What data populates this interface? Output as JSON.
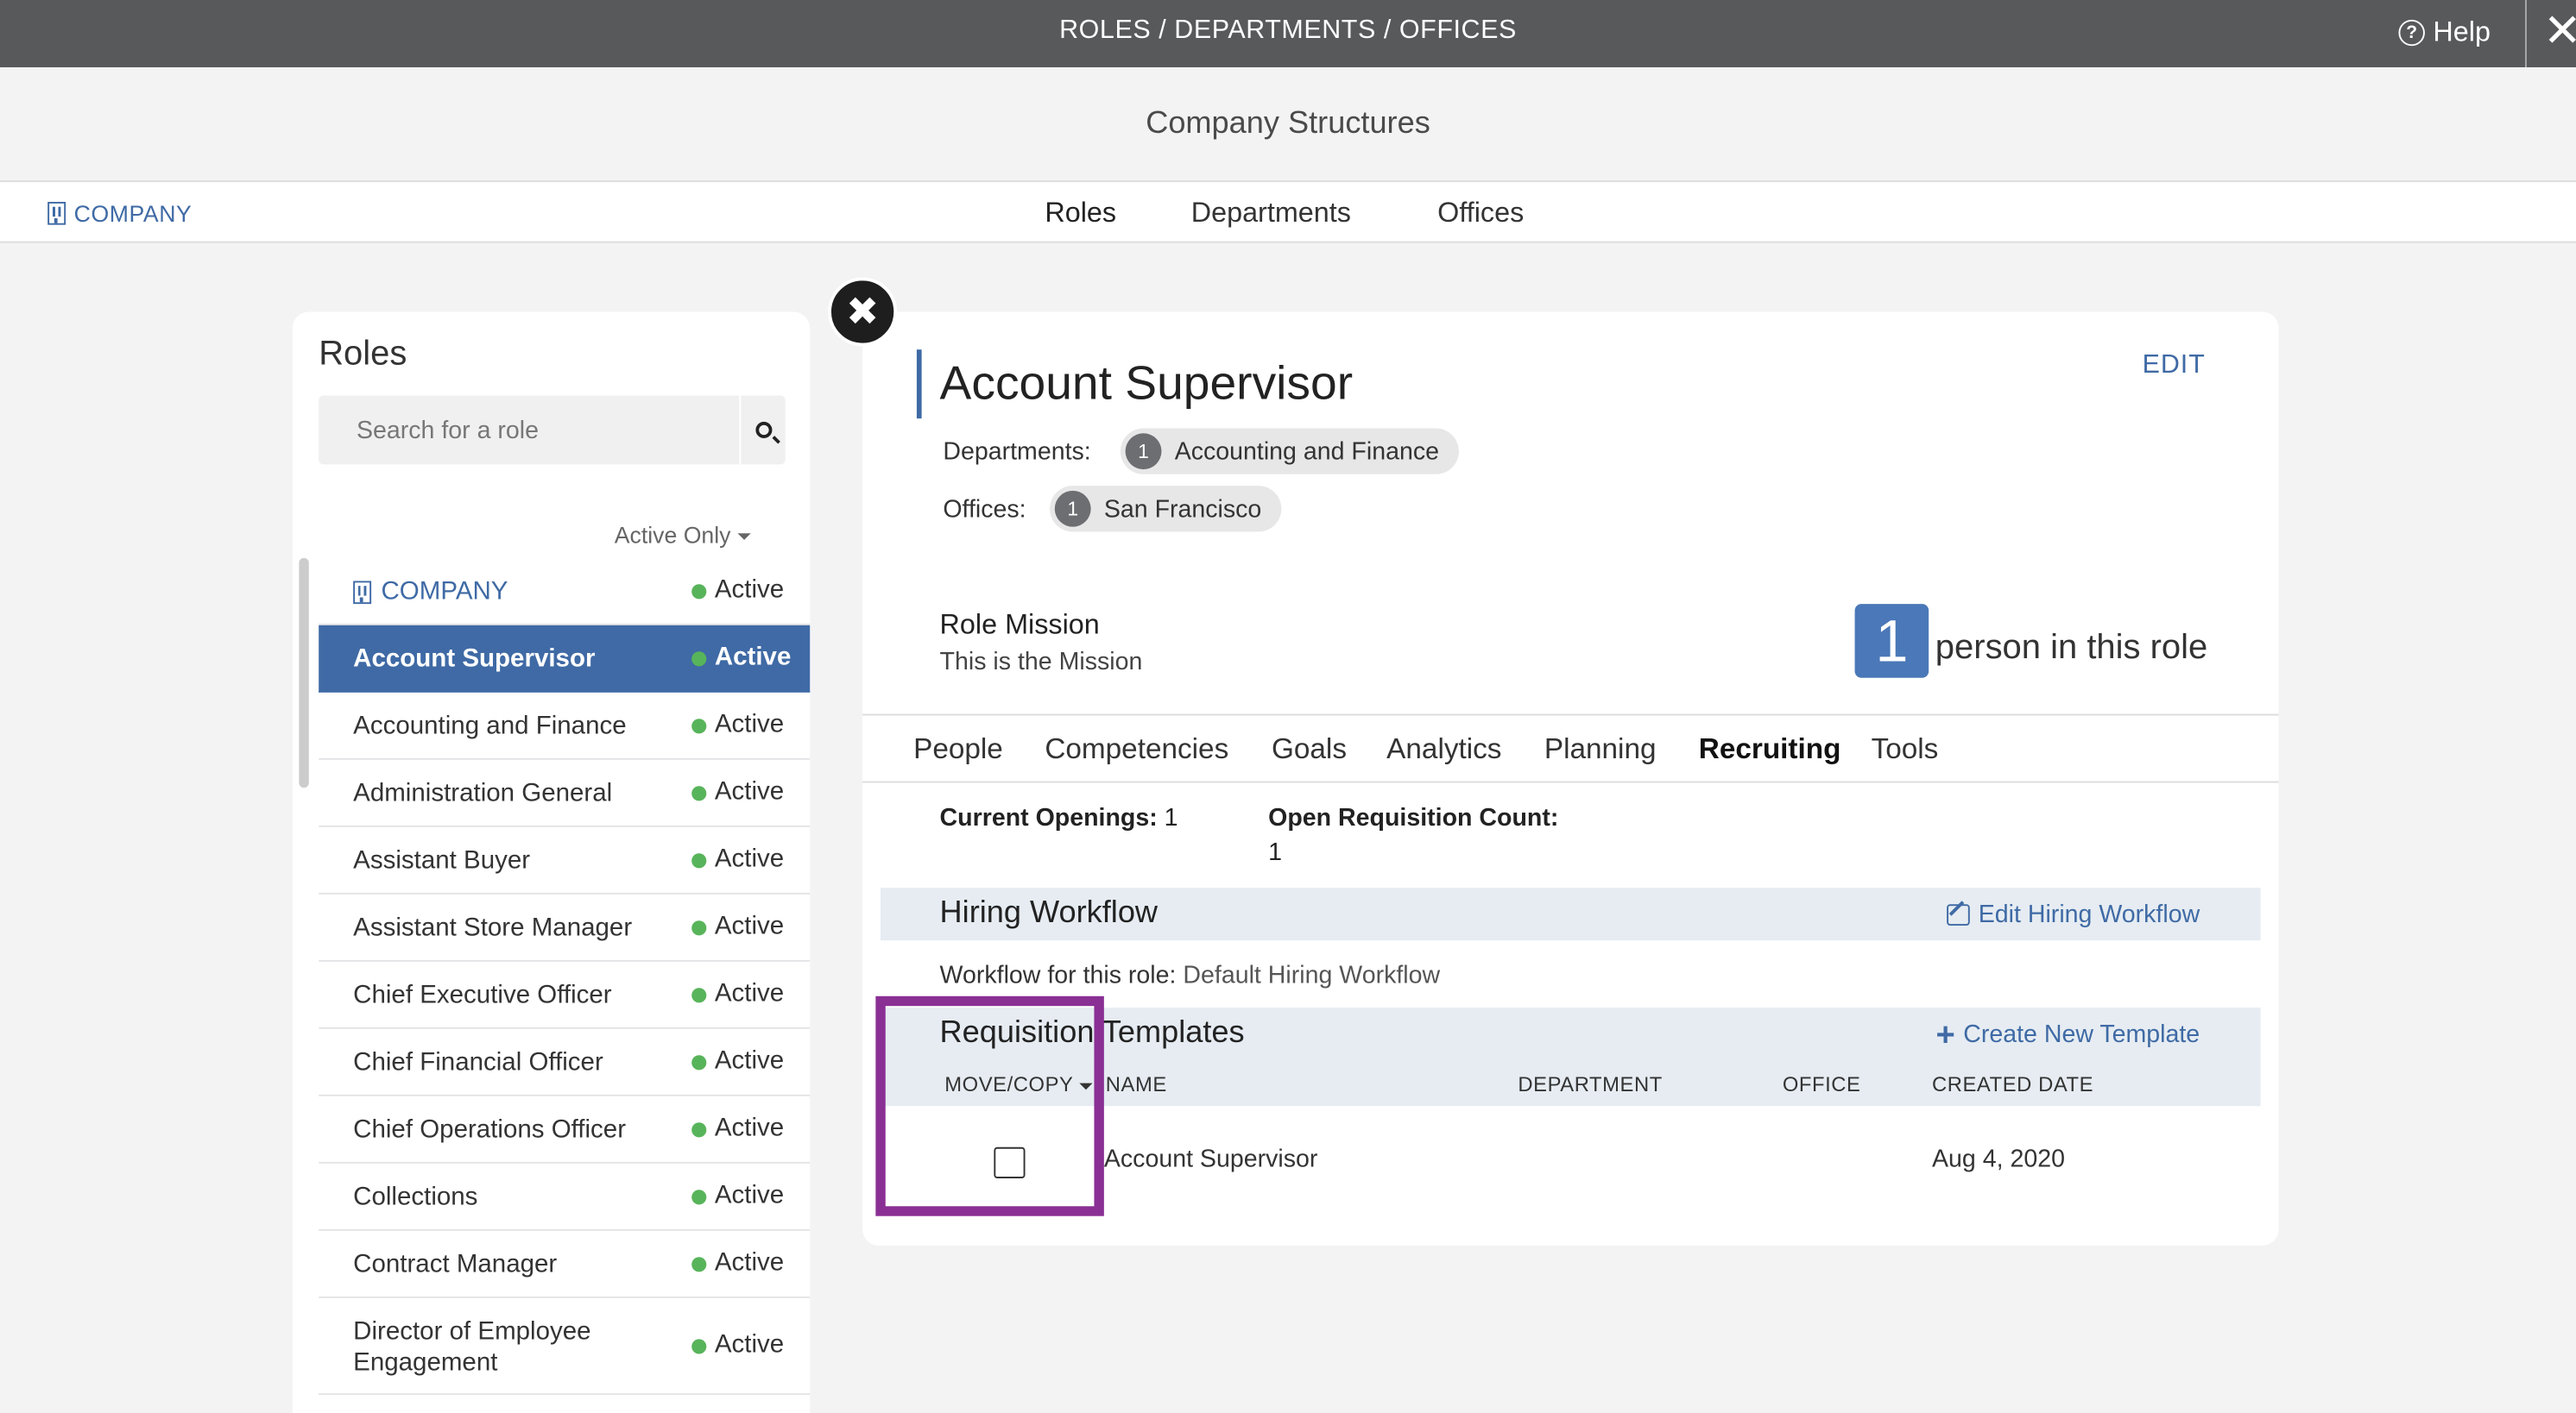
{
  "topbar": {
    "title": "ROLES / DEPARTMENTS / OFFICES",
    "help_label": "Help",
    "close_glyph": "✕"
  },
  "page": {
    "title": "Company Structures"
  },
  "nav": {
    "company_label": "COMPANY",
    "tabs": [
      {
        "label": "Roles"
      },
      {
        "label": "Departments"
      },
      {
        "label": "Offices"
      }
    ]
  },
  "roles_panel": {
    "header": "Roles",
    "search_placeholder": "Search for a role",
    "filter_label": "Active Only",
    "items": [
      {
        "name": "COMPANY",
        "status": "Active"
      },
      {
        "name": "Account Supervisor",
        "status": "Active"
      },
      {
        "name": "Accounting and Finance",
        "status": "Active"
      },
      {
        "name": "Administration General",
        "status": "Active"
      },
      {
        "name": "Assistant Buyer",
        "status": "Active"
      },
      {
        "name": "Assistant Store Manager",
        "status": "Active"
      },
      {
        "name": "Chief Executive Officer",
        "status": "Active"
      },
      {
        "name": "Chief Financial Officer",
        "status": "Active"
      },
      {
        "name": "Chief Operations Officer",
        "status": "Active"
      },
      {
        "name": "Collections",
        "status": "Active"
      },
      {
        "name": "Contract Manager",
        "status": "Active"
      },
      {
        "name": "Director of Employee Engagement",
        "status": "Active"
      }
    ],
    "colors": {
      "selected": "#3f6aa5",
      "active_dot": "#58b45a"
    }
  },
  "detail": {
    "close_glyph": "✖",
    "title": "Account Supervisor",
    "edit_label": "EDIT",
    "departments_label": "Departments:",
    "department": {
      "count": "1",
      "name": "Accounting and Finance"
    },
    "offices_label": "Offices:",
    "office": {
      "count": "1",
      "name": "San Francisco"
    },
    "mission_heading": "Role Mission",
    "mission_text": "This is the Mission",
    "people_count": "1",
    "people_label": "person in this role",
    "tabs": [
      {
        "label": "People"
      },
      {
        "label": "Competencies"
      },
      {
        "label": "Goals"
      },
      {
        "label": "Analytics"
      },
      {
        "label": "Planning"
      },
      {
        "label": "Recruiting"
      },
      {
        "label": "Tools"
      }
    ],
    "recruiting": {
      "current_openings_label": "Current Openings:",
      "current_openings_value": "1",
      "open_req_label": "Open Requisition Count:",
      "open_req_value": "1",
      "hiring_workflow_heading": "Hiring Workflow",
      "edit_workflow_label": "Edit Hiring Workflow",
      "workflow_label": "Workflow for this role:",
      "workflow_value": "Default Hiring Workflow",
      "templates_heading": "Requisition Templates",
      "create_template_label": "Create New Template",
      "columns": {
        "move_copy": "MOVE/COPY",
        "name": "NAME",
        "department": "DEPARTMENT",
        "office": "OFFICE",
        "created": "CREATED DATE"
      },
      "rows": [
        {
          "name": "Account Supervisor",
          "department": "",
          "office": "",
          "created": "Aug 4, 2020"
        }
      ]
    }
  },
  "highlight_color": "#8a2f94"
}
